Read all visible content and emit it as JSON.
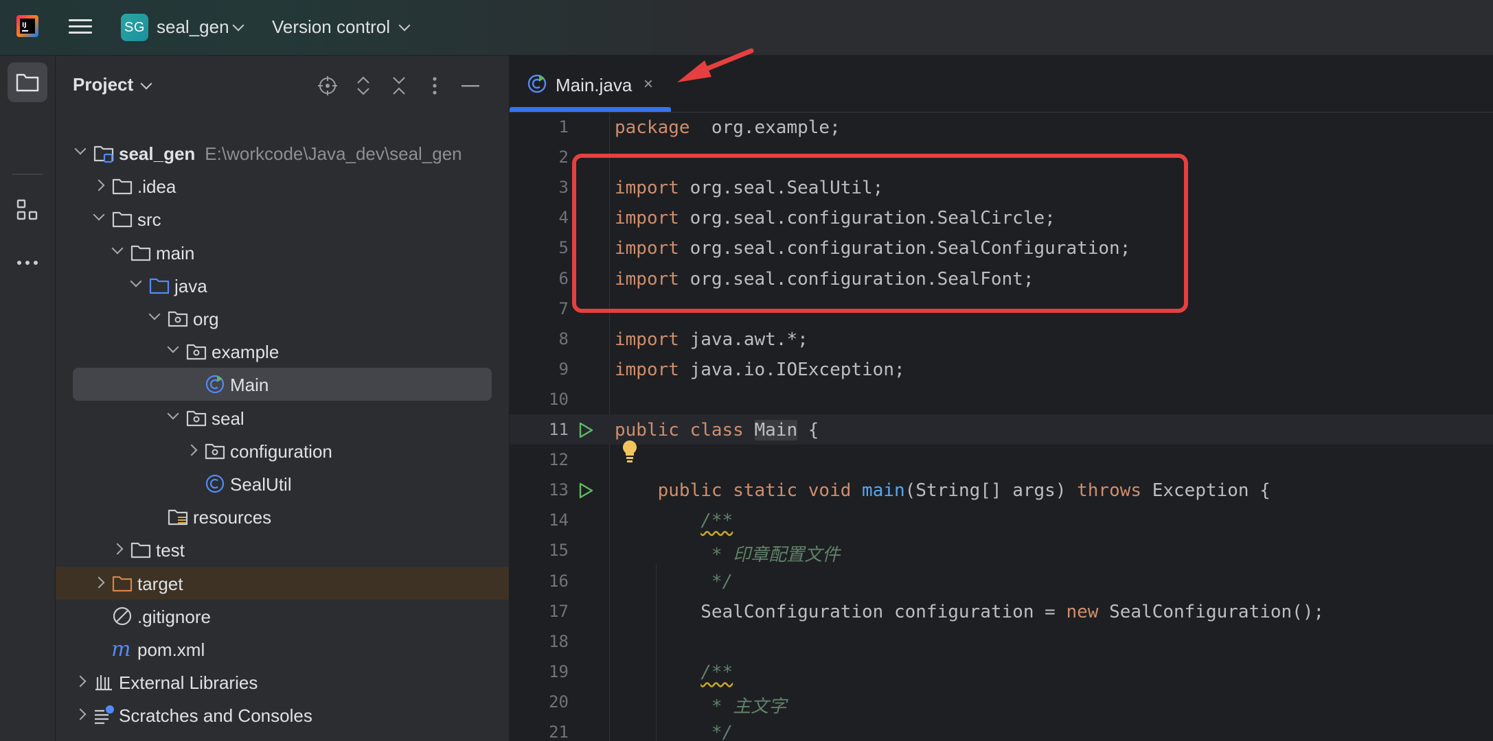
{
  "titlebar": {
    "logo_icon": "intellij-logo-icon",
    "menu_icon": "hamburger-menu-icon",
    "project_badge": "SG",
    "project_name": "seal_gen",
    "vcs_label": "Version control"
  },
  "toolstrip": {
    "items": [
      {
        "icon": "folder-icon",
        "active": true
      },
      {
        "icon": "structure-icon",
        "active": false
      },
      {
        "icon": "more-horizontal-icon",
        "active": false
      }
    ]
  },
  "project_panel": {
    "title": "Project",
    "actions": [
      "locate-icon",
      "expand-all-icon",
      "collapse-all-icon",
      "more-vertical-icon",
      "minimize-icon"
    ],
    "tree": [
      {
        "label": "seal_gen",
        "path": "E:\\workcode\\Java_dev\\seal_gen",
        "icon": "module-folder-icon",
        "state": "open"
      },
      {
        "label": ".idea",
        "icon": "folder-icon",
        "state": "closed"
      },
      {
        "label": "src",
        "icon": "folder-icon",
        "state": "open"
      },
      {
        "label": "main",
        "icon": "folder-icon",
        "state": "open"
      },
      {
        "label": "java",
        "icon": "source-folder-icon",
        "state": "open"
      },
      {
        "label": "org",
        "icon": "package-icon",
        "state": "open"
      },
      {
        "label": "example",
        "icon": "package-icon",
        "state": "open"
      },
      {
        "label": "Main",
        "icon": "java-class-runnable-icon",
        "state": "leaf",
        "selected": true
      },
      {
        "label": "seal",
        "icon": "package-icon",
        "state": "open"
      },
      {
        "label": "configuration",
        "icon": "package-icon",
        "state": "closed"
      },
      {
        "label": "SealUtil",
        "icon": "java-class-icon",
        "state": "leaf"
      },
      {
        "label": "resources",
        "icon": "resources-folder-icon",
        "state": "leaf"
      },
      {
        "label": "test",
        "icon": "folder-icon",
        "state": "closed"
      },
      {
        "label": "target",
        "icon": "excluded-folder-icon",
        "state": "closed",
        "excluded": true
      },
      {
        "label": ".gitignore",
        "icon": "ignored-file-icon",
        "state": "leaf"
      },
      {
        "label": "pom.xml",
        "icon": "maven-icon",
        "state": "leaf"
      },
      {
        "label": "External Libraries",
        "icon": "library-icon",
        "state": "closed"
      },
      {
        "label": "Scratches and Consoles",
        "icon": "scratches-icon",
        "state": "closed"
      }
    ]
  },
  "editor": {
    "tab": {
      "label": "Main.java",
      "icon": "java-class-runnable-icon",
      "close": "×"
    },
    "lines": [
      {
        "n": "1",
        "tokens": [
          [
            "kw",
            "package"
          ],
          [
            "",
            "  org.example;"
          ]
        ]
      },
      {
        "n": "2",
        "tokens": []
      },
      {
        "n": "3",
        "tokens": [
          [
            "kw",
            "import"
          ],
          [
            "",
            " org.seal.SealUtil;"
          ]
        ]
      },
      {
        "n": "4",
        "tokens": [
          [
            "kw",
            "import"
          ],
          [
            "",
            " org.seal.configuration.SealCircle;"
          ]
        ]
      },
      {
        "n": "5",
        "tokens": [
          [
            "kw",
            "import"
          ],
          [
            "",
            " org.seal.configuration.SealConfiguration;"
          ]
        ]
      },
      {
        "n": "6",
        "tokens": [
          [
            "kw",
            "import"
          ],
          [
            "",
            " org.seal.configuration.SealFont;"
          ]
        ]
      },
      {
        "n": "7",
        "tokens": []
      },
      {
        "n": "8",
        "tokens": [
          [
            "kw",
            "import"
          ],
          [
            "",
            " java.awt.*;"
          ]
        ]
      },
      {
        "n": "9",
        "tokens": [
          [
            "kw",
            "import"
          ],
          [
            "",
            " java.io.IOException;"
          ]
        ]
      },
      {
        "n": "10",
        "tokens": []
      },
      {
        "n": "11",
        "tokens": [
          [
            "kw",
            "public class "
          ],
          [
            "hl",
            "Main"
          ],
          [
            "",
            " {"
          ]
        ],
        "current": true,
        "run": true
      },
      {
        "n": "12",
        "tokens": []
      },
      {
        "n": "13",
        "tokens": [
          [
            "",
            "    "
          ],
          [
            "kw",
            "public static void "
          ],
          [
            "fn",
            "main"
          ],
          [
            "",
            "(String[] args) "
          ],
          [
            "kw",
            "throws"
          ],
          [
            "",
            " Exception {"
          ]
        ],
        "run": true
      },
      {
        "n": "14",
        "tokens": [
          [
            "",
            "        "
          ],
          [
            "docsq",
            "/**"
          ]
        ]
      },
      {
        "n": "15",
        "tokens": [
          [
            "",
            "        "
          ],
          [
            "doc",
            " * 印章配置文件"
          ]
        ]
      },
      {
        "n": "16",
        "tokens": [
          [
            "",
            "        "
          ],
          [
            "doc",
            " */"
          ]
        ]
      },
      {
        "n": "17",
        "tokens": [
          [
            "",
            "        SealConfiguration configuration = "
          ],
          [
            "kw",
            "new"
          ],
          [
            "",
            " SealConfiguration();"
          ]
        ]
      },
      {
        "n": "18",
        "tokens": []
      },
      {
        "n": "19",
        "tokens": [
          [
            "",
            "        "
          ],
          [
            "docsq",
            "/**"
          ]
        ]
      },
      {
        "n": "20",
        "tokens": [
          [
            "",
            "        "
          ],
          [
            "doc",
            " * 主文字"
          ]
        ]
      },
      {
        "n": "21",
        "tokens": [
          [
            "",
            "        "
          ],
          [
            "doc",
            " */"
          ]
        ]
      }
    ]
  },
  "colors": {
    "accent": "#3574f0",
    "annotation": "#e5403f",
    "keyword": "#cf8e6d",
    "function": "#56a8f5",
    "doc_comment": "#5f826b"
  }
}
